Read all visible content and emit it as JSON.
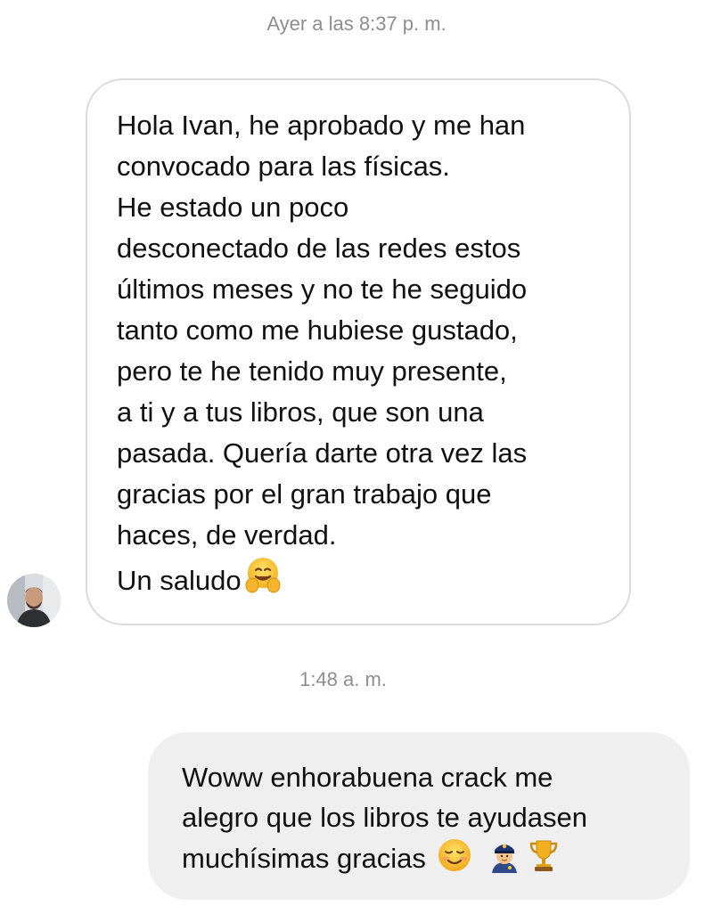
{
  "thread": {
    "timestamps": {
      "first": "Ayer a las 8:37 p. m.",
      "second": "1:48 a. m."
    },
    "incoming_message": {
      "lines": [
        "Hola Ivan, he aprobado y me han",
        "convocado para las físicas.",
        "He estado un poco",
        "desconectado de las redes estos",
        "últimos meses y no te he seguido",
        "tanto como me hubiese gustado,",
        "pero te he tenido muy presente,",
        "a ti y a tus libros, que son una",
        "pasada. Quería darte otra vez las",
        "gracias por el gran trabajo que",
        "haces, de verdad.",
        "Un saludo"
      ],
      "emoji": "hugging-face-icon"
    },
    "outgoing_message": {
      "lines": [
        "Woww enhorabuena crack me",
        "alegro que los libros te ayudasen",
        "muchísimas gracias"
      ],
      "emojis": [
        "smiling-face-icon",
        "police-officer-icon",
        "trophy-icon"
      ]
    },
    "avatar": "sender-avatar"
  },
  "colors": {
    "timestamp": "#8e8e8e",
    "incoming_border": "#dbdbdb",
    "outgoing_bg": "#efefef",
    "text": "#111111"
  }
}
